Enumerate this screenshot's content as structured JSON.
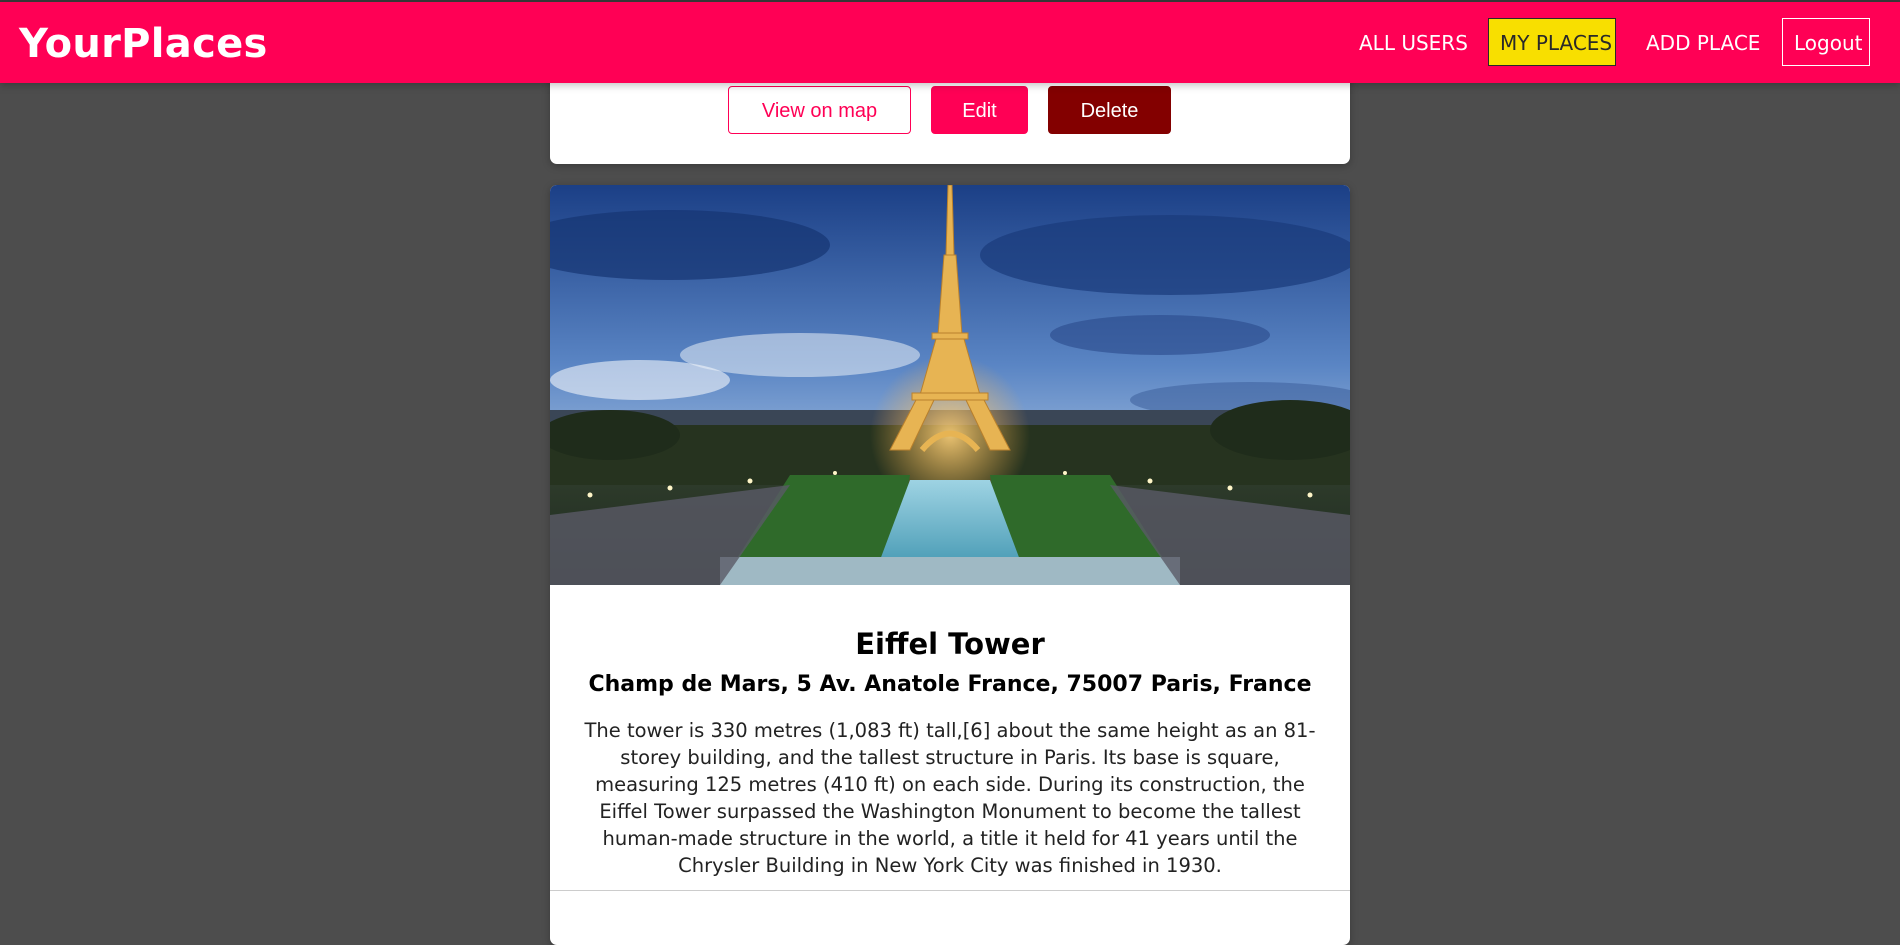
{
  "header": {
    "brand": "YourPlaces",
    "nav": [
      {
        "label": "ALL USERS"
      },
      {
        "label": "MY PLACES",
        "active": true
      },
      {
        "label": "ADD PLACE"
      },
      {
        "label": "Logout"
      }
    ]
  },
  "previous_card": {
    "actions": {
      "view_on_map": "View on map",
      "edit": "Edit",
      "delete": "Delete"
    }
  },
  "place": {
    "title": "Eiffel Tower",
    "address": "Champ de Mars, 5 Av. Anatole France, 75007 Paris, France",
    "description": "The tower is 330 metres (1,083 ft) tall,[6] about the same height as an 81-storey building, and the tallest structure in Paris. Its base is square, measuring 125 metres (410 ft) on each side. During its construction, the Eiffel Tower surpassed the Washington Monument to become the tallest human-made structure in the world, a title it held for 41 years until the Chrysler Building in New York City was finished in 1930."
  },
  "colors": {
    "brand": "#ff0055",
    "active_nav": "#f8df00",
    "delete": "#830000",
    "background": "#4d4d4d"
  }
}
